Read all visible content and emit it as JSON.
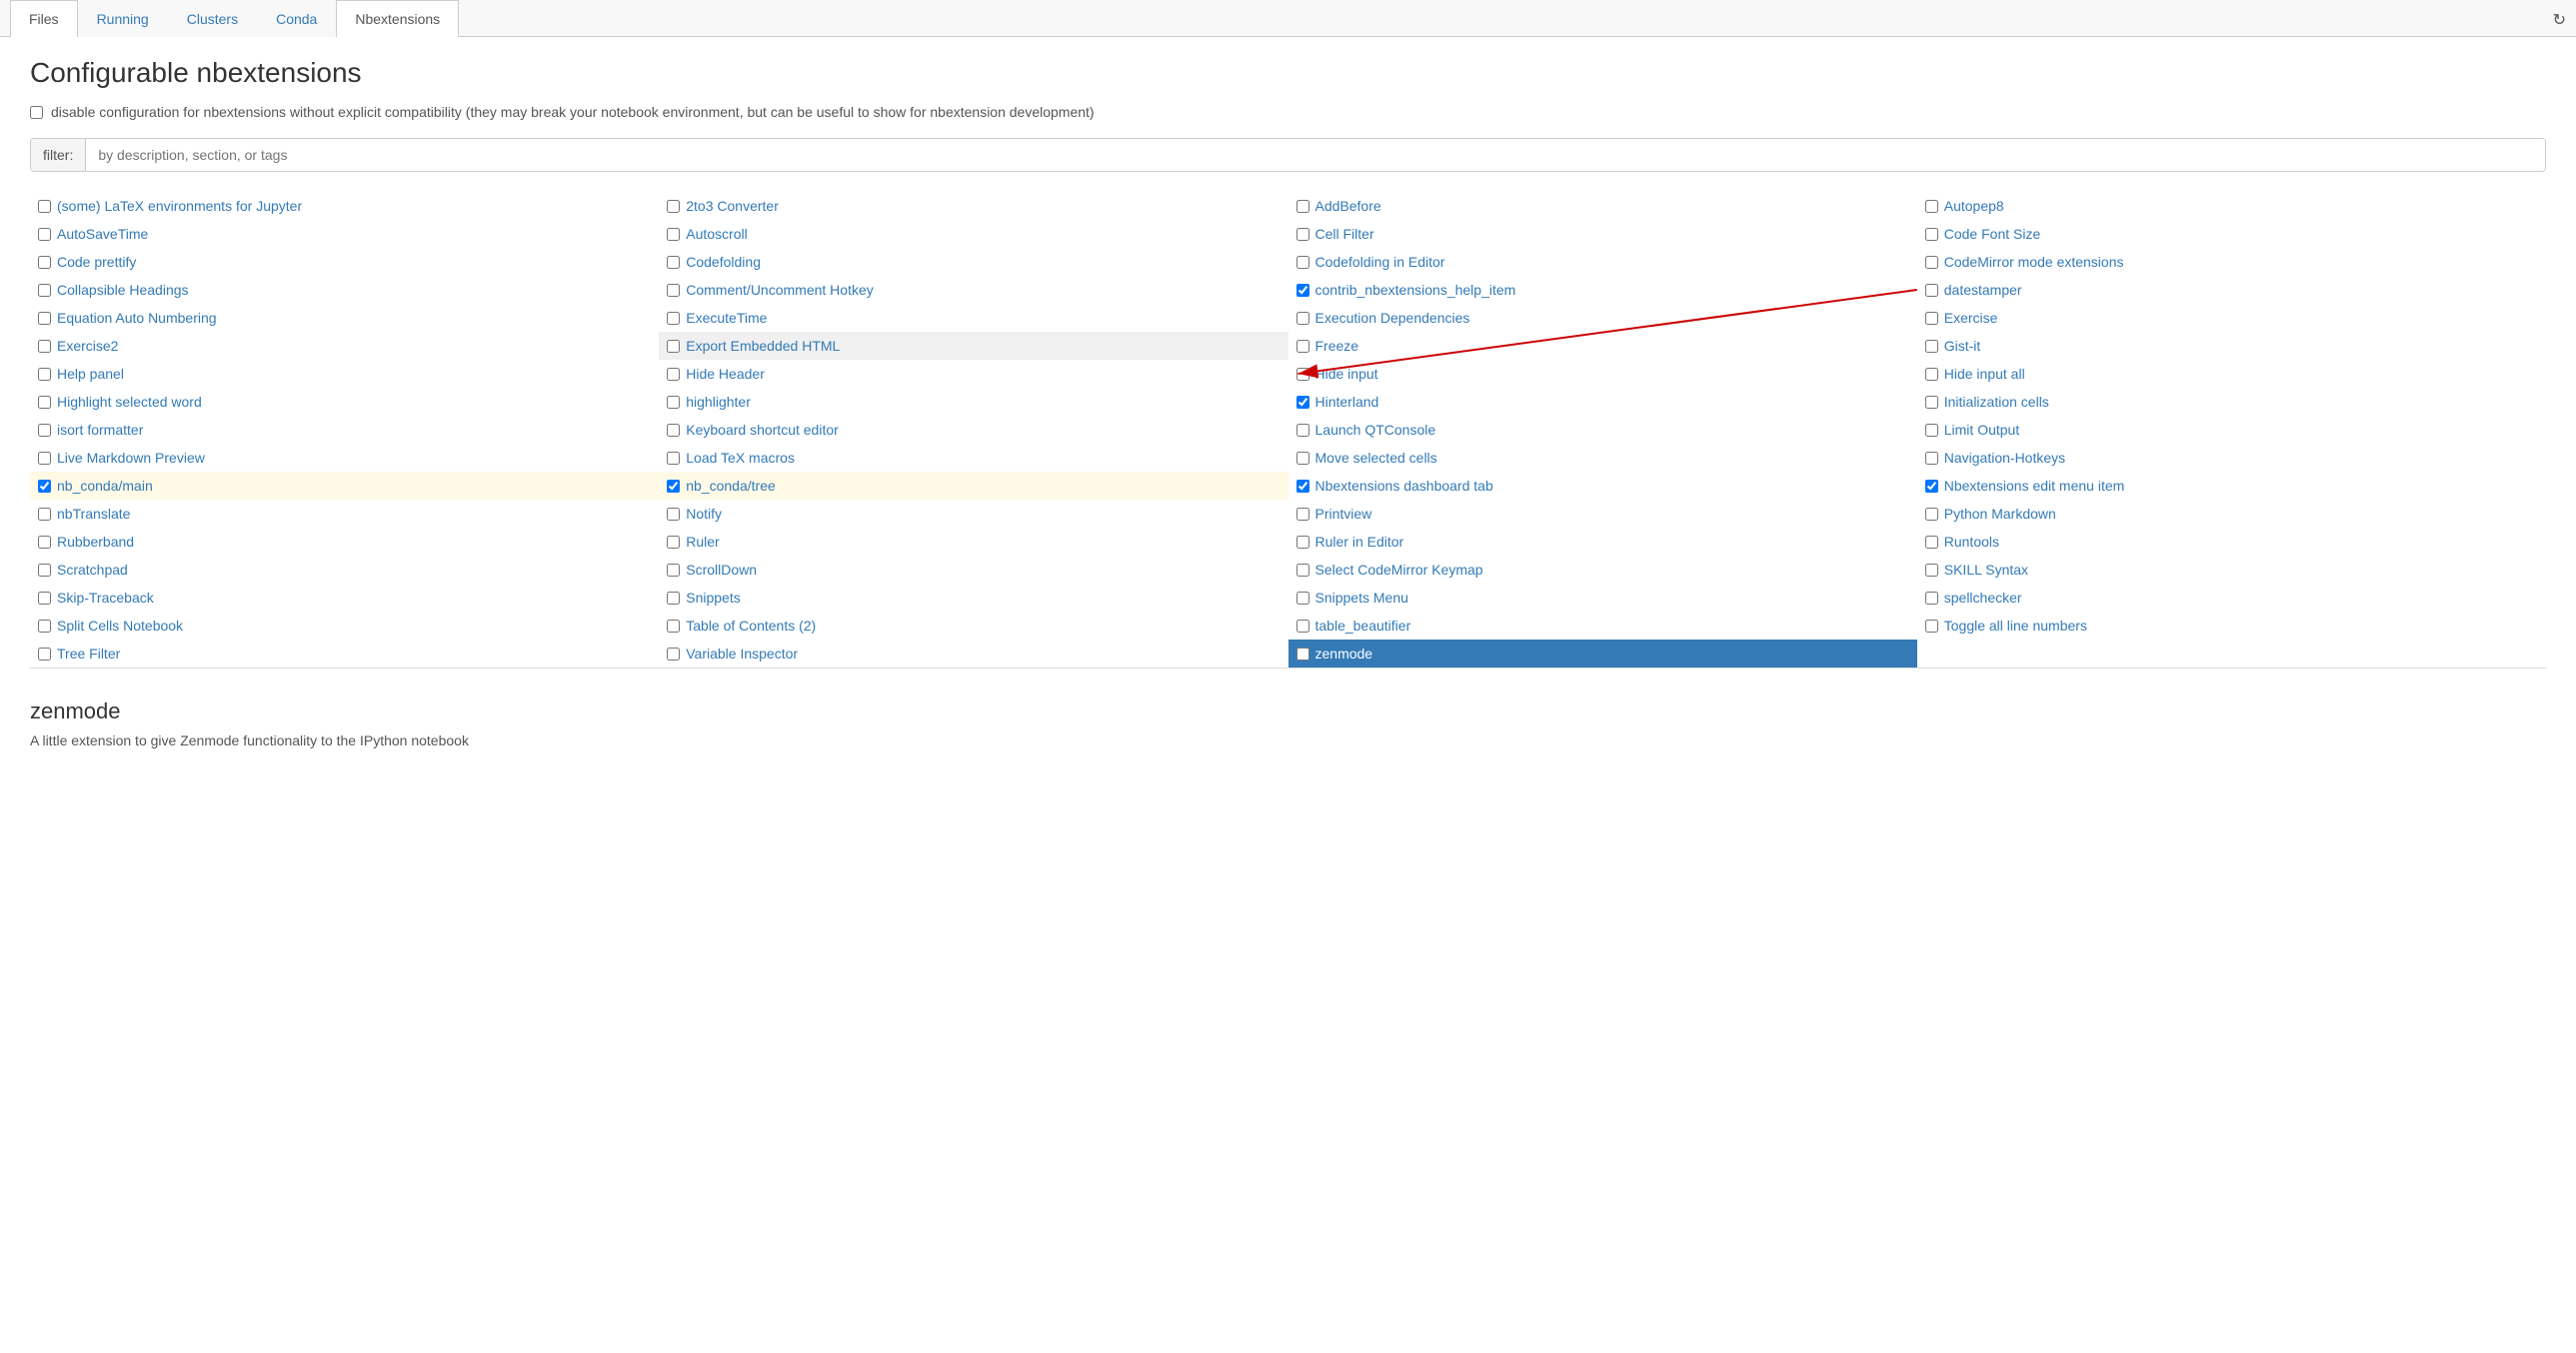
{
  "tabs": [
    {
      "label": "Files",
      "active": false
    },
    {
      "label": "Running",
      "active": false
    },
    {
      "label": "Clusters",
      "active": false
    },
    {
      "label": "Conda",
      "active": false
    },
    {
      "label": "Nbextensions",
      "active": true
    }
  ],
  "page": {
    "title": "Configurable nbextensions",
    "refresh_icon": "↻",
    "compat_checkbox_checked": false,
    "compat_label": "disable configuration for nbextensions without explicit compatibility (they may break your notebook environment, but can be useful to show for nbextension development)",
    "filter_label": "filter:",
    "filter_placeholder": "by description, section, or tags"
  },
  "extensions": [
    {
      "id": "some-latex",
      "label": "(some) LaTeX environments for Jupyter",
      "checked": false,
      "highlighted": false,
      "selected": false
    },
    {
      "id": "2to3",
      "label": "2to3 Converter",
      "checked": false,
      "highlighted": false,
      "selected": false
    },
    {
      "id": "addbefore",
      "label": "AddBefore",
      "checked": false,
      "highlighted": false,
      "selected": false
    },
    {
      "id": "autopep8",
      "label": "Autopep8",
      "checked": false,
      "highlighted": false,
      "selected": false
    },
    {
      "id": "autosavetime",
      "label": "AutoSaveTime",
      "checked": false,
      "highlighted": false,
      "selected": false
    },
    {
      "id": "autoscroll",
      "label": "Autoscroll",
      "checked": false,
      "highlighted": false,
      "selected": false
    },
    {
      "id": "cell-filter",
      "label": "Cell Filter",
      "checked": false,
      "highlighted": false,
      "selected": false
    },
    {
      "id": "code-font-size",
      "label": "Code Font Size",
      "checked": false,
      "highlighted": false,
      "selected": false
    },
    {
      "id": "code-prettify",
      "label": "Code prettify",
      "checked": false,
      "highlighted": false,
      "selected": false
    },
    {
      "id": "codefolding",
      "label": "Codefolding",
      "checked": false,
      "highlighted": false,
      "selected": false
    },
    {
      "id": "codefolding-editor",
      "label": "Codefolding in Editor",
      "checked": false,
      "highlighted": false,
      "selected": false
    },
    {
      "id": "codemirror-mode",
      "label": "CodeMirror mode extensions",
      "checked": false,
      "highlighted": false,
      "selected": false
    },
    {
      "id": "collapsible-headings",
      "label": "Collapsible Headings",
      "checked": false,
      "highlighted": false,
      "selected": false
    },
    {
      "id": "comment-uncomment",
      "label": "Comment/Uncomment Hotkey",
      "checked": false,
      "highlighted": false,
      "selected": false
    },
    {
      "id": "contrib-nbextensions",
      "label": "contrib_nbextensions_help_item",
      "checked": true,
      "highlighted": false,
      "selected": false
    },
    {
      "id": "datestamper",
      "label": "datestamper",
      "checked": false,
      "highlighted": false,
      "selected": false
    },
    {
      "id": "equation-auto",
      "label": "Equation Auto Numbering",
      "checked": false,
      "highlighted": false,
      "selected": false
    },
    {
      "id": "executetime",
      "label": "ExecuteTime",
      "checked": false,
      "highlighted": false,
      "selected": false
    },
    {
      "id": "execution-deps",
      "label": "Execution Dependencies",
      "checked": false,
      "highlighted": false,
      "selected": false
    },
    {
      "id": "exercise",
      "label": "Exercise",
      "checked": false,
      "highlighted": false,
      "selected": false
    },
    {
      "id": "exercise2",
      "label": "Exercise2",
      "checked": false,
      "highlighted": false,
      "selected": false
    },
    {
      "id": "export-embedded",
      "label": "Export Embedded HTML",
      "checked": false,
      "highlighted": true,
      "selected": false,
      "export": true
    },
    {
      "id": "freeze",
      "label": "Freeze",
      "checked": false,
      "highlighted": false,
      "selected": false
    },
    {
      "id": "gist-it",
      "label": "Gist-it",
      "checked": false,
      "highlighted": false,
      "selected": false
    },
    {
      "id": "help-panel",
      "label": "Help panel",
      "checked": false,
      "highlighted": false,
      "selected": false
    },
    {
      "id": "hide-header",
      "label": "Hide Header",
      "checked": false,
      "highlighted": false,
      "selected": false
    },
    {
      "id": "hide-input",
      "label": "Hide input",
      "checked": false,
      "highlighted": false,
      "selected": false
    },
    {
      "id": "hide-input-all",
      "label": "Hide input all",
      "checked": false,
      "highlighted": false,
      "selected": false
    },
    {
      "id": "highlight-selected",
      "label": "Highlight selected word",
      "checked": false,
      "highlighted": false,
      "selected": false
    },
    {
      "id": "highlighter",
      "label": "highlighter",
      "checked": false,
      "highlighted": false,
      "selected": false
    },
    {
      "id": "hinterland",
      "label": "Hinterland",
      "checked": true,
      "highlighted": false,
      "selected": false
    },
    {
      "id": "init-cells",
      "label": "Initialization cells",
      "checked": false,
      "highlighted": false,
      "selected": false
    },
    {
      "id": "isort",
      "label": "isort formatter",
      "checked": false,
      "highlighted": false,
      "selected": false
    },
    {
      "id": "keyboard-shortcut",
      "label": "Keyboard shortcut editor",
      "checked": false,
      "highlighted": false,
      "selected": false
    },
    {
      "id": "launch-qtconsole",
      "label": "Launch QTConsole",
      "checked": false,
      "highlighted": false,
      "selected": false
    },
    {
      "id": "limit-output",
      "label": "Limit Output",
      "checked": false,
      "highlighted": false,
      "selected": false
    },
    {
      "id": "live-markdown",
      "label": "Live Markdown Preview",
      "checked": false,
      "highlighted": false,
      "selected": false
    },
    {
      "id": "load-tex",
      "label": "Load TeX macros",
      "checked": false,
      "highlighted": false,
      "selected": false
    },
    {
      "id": "move-cells",
      "label": "Move selected cells",
      "checked": false,
      "highlighted": false,
      "selected": false
    },
    {
      "id": "navigation-hotkeys",
      "label": "Navigation-Hotkeys",
      "checked": false,
      "highlighted": false,
      "selected": false
    },
    {
      "id": "nb-conda-main",
      "label": "nb_conda/main",
      "checked": true,
      "highlighted": true,
      "selected": false
    },
    {
      "id": "nb-conda-tree",
      "label": "nb_conda/tree",
      "checked": true,
      "highlighted": true,
      "selected": false
    },
    {
      "id": "nbextensions-dashboard",
      "label": "Nbextensions dashboard tab",
      "checked": true,
      "highlighted": false,
      "selected": false
    },
    {
      "id": "nbextensions-edit-menu",
      "label": "Nbextensions edit menu item",
      "checked": true,
      "highlighted": false,
      "selected": false
    },
    {
      "id": "nbtranslate",
      "label": "nbTranslate",
      "checked": false,
      "highlighted": false,
      "selected": false
    },
    {
      "id": "notify",
      "label": "Notify",
      "checked": false,
      "highlighted": false,
      "selected": false
    },
    {
      "id": "printview",
      "label": "Printview",
      "checked": false,
      "highlighted": false,
      "selected": false
    },
    {
      "id": "python-markdown",
      "label": "Python Markdown",
      "checked": false,
      "highlighted": false,
      "selected": false
    },
    {
      "id": "rubberband",
      "label": "Rubberband",
      "checked": false,
      "highlighted": false,
      "selected": false
    },
    {
      "id": "ruler",
      "label": "Ruler",
      "checked": false,
      "highlighted": false,
      "selected": false
    },
    {
      "id": "ruler-in-editor",
      "label": "Ruler in Editor",
      "checked": false,
      "highlighted": false,
      "selected": false
    },
    {
      "id": "runtools",
      "label": "Runtools",
      "checked": false,
      "highlighted": false,
      "selected": false
    },
    {
      "id": "scratchpad",
      "label": "Scratchpad",
      "checked": false,
      "highlighted": false,
      "selected": false
    },
    {
      "id": "scrolldown",
      "label": "ScrollDown",
      "checked": false,
      "highlighted": false,
      "selected": false
    },
    {
      "id": "select-codemirror",
      "label": "Select CodeMirror Keymap",
      "checked": false,
      "highlighted": false,
      "selected": false
    },
    {
      "id": "skill-syntax",
      "label": "SKILL Syntax",
      "checked": false,
      "highlighted": false,
      "selected": false
    },
    {
      "id": "skip-traceback",
      "label": "Skip-Traceback",
      "checked": false,
      "highlighted": false,
      "selected": false
    },
    {
      "id": "snippets",
      "label": "Snippets",
      "checked": false,
      "highlighted": false,
      "selected": false
    },
    {
      "id": "snippets-menu",
      "label": "Snippets Menu",
      "checked": false,
      "highlighted": false,
      "selected": false
    },
    {
      "id": "spellchecker",
      "label": "spellchecker",
      "checked": false,
      "highlighted": false,
      "selected": false
    },
    {
      "id": "split-cells",
      "label": "Split Cells Notebook",
      "checked": false,
      "highlighted": false,
      "selected": false
    },
    {
      "id": "table-of-contents",
      "label": "Table of Contents (2)",
      "checked": false,
      "highlighted": false,
      "selected": false
    },
    {
      "id": "table-beautifier",
      "label": "table_beautifier",
      "checked": false,
      "highlighted": false,
      "selected": false
    },
    {
      "id": "toggle-line-numbers",
      "label": "Toggle all line numbers",
      "checked": false,
      "highlighted": false,
      "selected": false
    },
    {
      "id": "tree-filter",
      "label": "Tree Filter",
      "checked": false,
      "highlighted": false,
      "selected": false
    },
    {
      "id": "variable-inspector",
      "label": "Variable Inspector",
      "checked": false,
      "highlighted": false,
      "selected": false
    },
    {
      "id": "zenmode",
      "label": "zenmode",
      "checked": false,
      "highlighted": false,
      "selected": true
    }
  ],
  "detail": {
    "title": "zenmode",
    "description": "A little extension to give Zenmode functionality to the IPython notebook"
  }
}
